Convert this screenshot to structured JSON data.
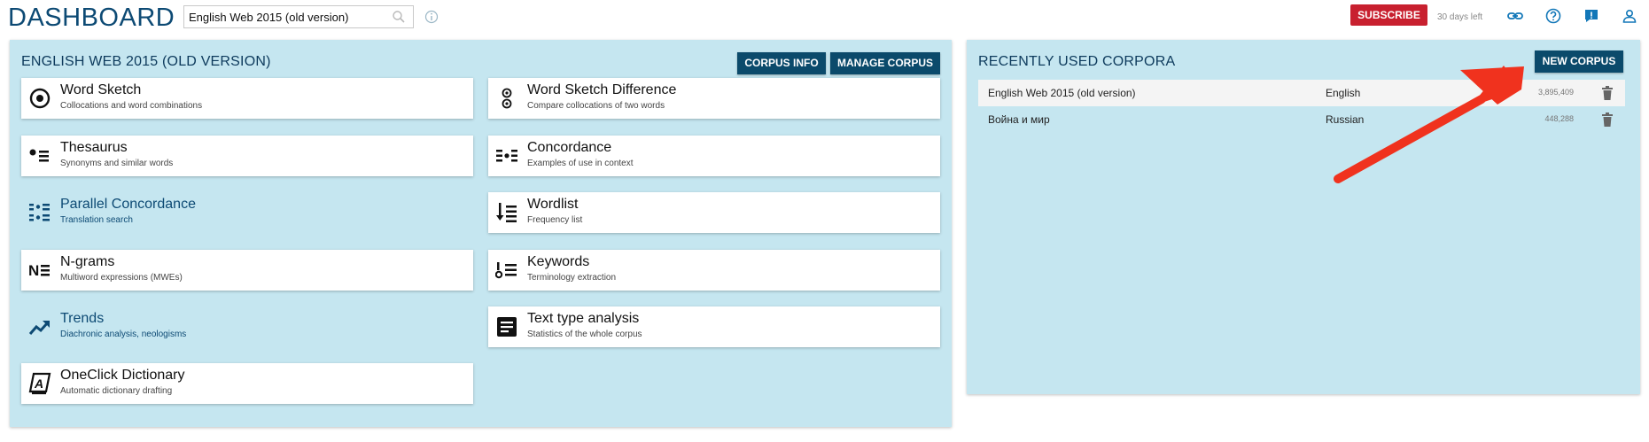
{
  "header": {
    "logo": "DASHBOARD",
    "search_value": "English Web 2015 (old version)",
    "subscribe_label": "SUBSCRIBE",
    "days_left": "30 days left"
  },
  "main_panel": {
    "title": "ENGLISH WEB 2015 (OLD VERSION)",
    "corpus_info_label": "CORPUS INFO",
    "manage_corpus_label": "MANAGE CORPUS",
    "tools": [
      {
        "name": "Word Sketch",
        "desc": "Collocations and word combinations",
        "icon": "target-icon"
      },
      {
        "name": "Word Sketch Difference",
        "desc": "Compare collocations of two words",
        "icon": "double-target-icon"
      },
      {
        "name": "Thesaurus",
        "desc": "Synonyms and similar words",
        "icon": "bullet-list-icon"
      },
      {
        "name": "Concordance",
        "desc": "Examples of use in context",
        "icon": "concordance-icon"
      },
      {
        "name": "Parallel Concordance",
        "desc": "Translation search",
        "icon": "parallel-concordance-icon"
      },
      {
        "name": "Wordlist",
        "desc": "Frequency list",
        "icon": "sorted-list-icon"
      },
      {
        "name": "N-grams",
        "desc": "Multiword expressions (MWEs)",
        "icon": "ngrams-icon"
      },
      {
        "name": "Keywords",
        "desc": "Terminology extraction",
        "icon": "key-list-icon"
      },
      {
        "name": "Trends",
        "desc": "Diachronic analysis, neologisms",
        "icon": "trending-up-icon"
      },
      {
        "name": "Text type analysis",
        "desc": "Statistics of the whole corpus",
        "icon": "document-icon"
      },
      {
        "name": "OneClick Dictionary",
        "desc": "Automatic dictionary drafting",
        "icon": "dictionary-icon"
      }
    ]
  },
  "recent_panel": {
    "title": "RECENTLY USED CORPORA",
    "new_corpus_label": "NEW CORPUS",
    "corpora": [
      {
        "name": "English Web 2015 (old version)",
        "language": "English",
        "size": "3,895,409"
      },
      {
        "name": "Война и мир",
        "language": "Russian",
        "size": "448,288"
      }
    ]
  },
  "colors": {
    "accent": "#0b4a6b",
    "subscribe": "#c8202f",
    "panel_bg": "#c5e6f0",
    "annotation_arrow": "#f0321e"
  }
}
